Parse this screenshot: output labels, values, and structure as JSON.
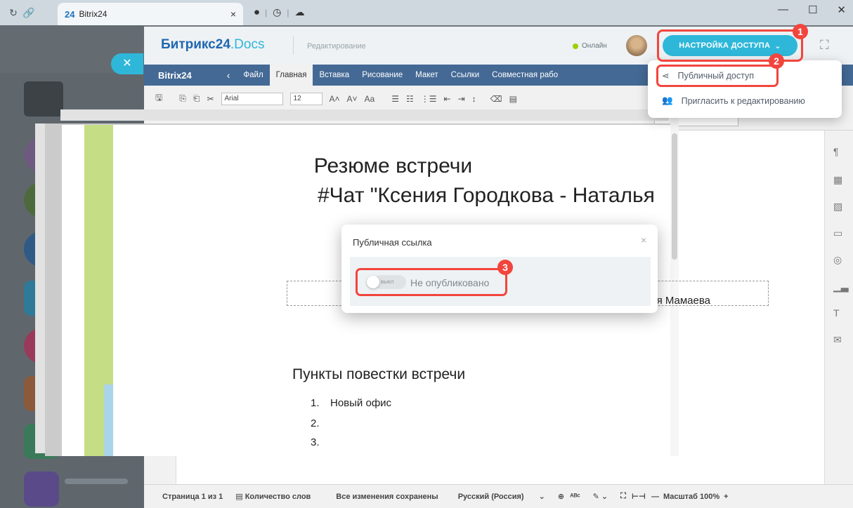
{
  "browser": {
    "tab_logo": "24",
    "tab_title": "Bitrix24",
    "tab_close": "×",
    "nav_reload": "C",
    "nav_link": "⊘"
  },
  "app": {
    "brand_main": "Битрикс24",
    "brand_docs": ".Docs",
    "mode_label": "Редактирование",
    "online_label": "Онлайн",
    "access_button": "НАСТРОЙКА ДОСТУПА"
  },
  "menubar": {
    "logo": "Bitrix24",
    "tabs": [
      "Файл",
      "Главная",
      "Вставка",
      "Рисование",
      "Макет",
      "Ссылки",
      "Совместная рабо"
    ]
  },
  "ribbon": {
    "font": "Arial",
    "size": "12"
  },
  "dropdown": {
    "items": [
      "Публичный доступ",
      "Пригласить к редактированию"
    ]
  },
  "document": {
    "title": "Резюме встречи",
    "subtitle": "#Чат \"Ксения Городкова - Наталья",
    "participant": "лья Мамаева",
    "agenda_heading": "Пункты повестки встречи",
    "list": [
      "1.",
      "Новый офис",
      "2.",
      "3."
    ]
  },
  "modal": {
    "title": "Публичная ссылка",
    "close": "×",
    "toggle_label": "выкл",
    "status": "Не опубликовано"
  },
  "statusbar": {
    "page": "Страница 1 из 1",
    "word_count": "Количество слов",
    "saved": "Все изменения сохранены",
    "language": "Русский (Россия)",
    "zoom": "Масштаб 100%"
  },
  "badges": [
    "1",
    "2",
    "3"
  ],
  "colors": {
    "accent": "#2fb7d9",
    "brand": "#2067b0",
    "highlight": "#f2453d",
    "toolbar": "#446995"
  }
}
